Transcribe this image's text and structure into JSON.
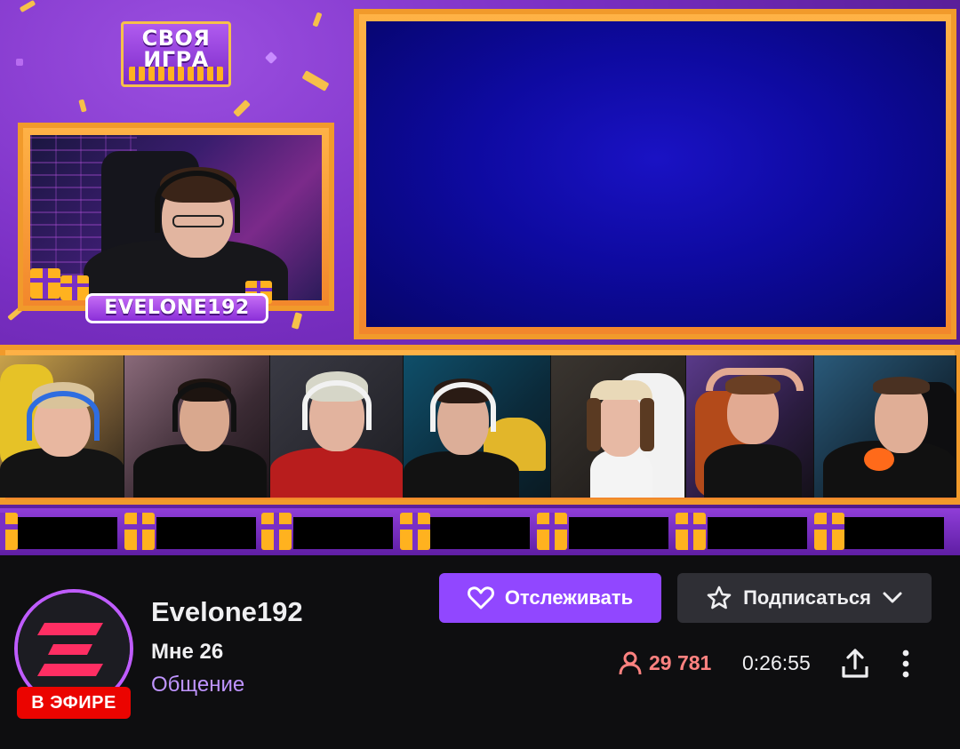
{
  "overlay": {
    "logo_line1": "СВОЯ",
    "logo_line2": "ИГРА",
    "host_name_badge": "EVELONE192"
  },
  "channel": {
    "name": "Evelone192",
    "title": "Мне 26",
    "category": "Общение",
    "live_label": "В ЭФИРЕ",
    "viewers": "29 781",
    "uptime": "0:26:55"
  },
  "buttons": {
    "follow_label": "Отслеживать",
    "subscribe_label": "Подписаться"
  },
  "icons": {
    "follow": "heart-icon",
    "subscribe": "star-icon",
    "subscribe_dropdown": "chevron-down-icon",
    "viewers": "person-icon",
    "share": "share-icon",
    "more": "more-vertical-icon"
  },
  "colors": {
    "accent_purple": "#9147ff",
    "live_red": "#eb0400",
    "viewers_red": "#ff8280",
    "category_purple": "#bf94ff",
    "avatar_logo_pink": "#ff2e63"
  }
}
